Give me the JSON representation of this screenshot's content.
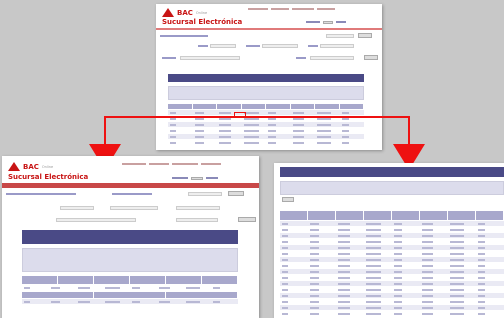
{
  "panels": {
    "top": {
      "brand": "BAC",
      "brand_sub": "Online",
      "title": "Sucursal Electrónica"
    },
    "left": {
      "brand": "BAC",
      "brand_sub": "Online",
      "title": "Sucursal Electrónica"
    },
    "right": {}
  },
  "colors": {
    "brand_red": "#c81414",
    "header_navy": "#4a4a86",
    "arrow_red": "#ee1111",
    "table_header": "#a8a8cc"
  },
  "icons": [
    "bac-logo-icon",
    "down-arrow-icon"
  ]
}
